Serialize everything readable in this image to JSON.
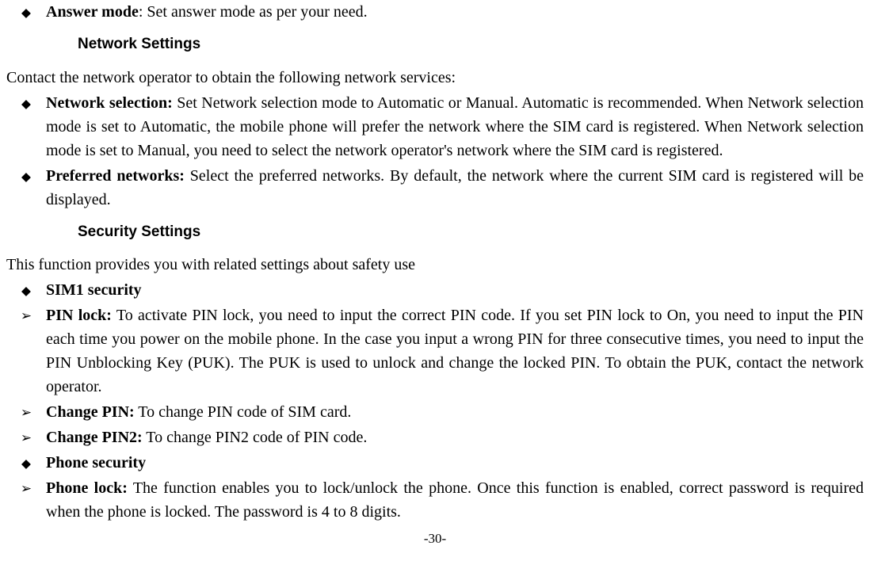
{
  "items": [
    {
      "bullet": "diamond",
      "label": "Answer mode",
      "sep": ": ",
      "text": "Set answer mode as per your need."
    }
  ],
  "heading1": "Network Settings",
  "para1": "Contact the network operator to obtain the following network services:",
  "networkItems": [
    {
      "bullet": "diamond",
      "label": "Network selection:",
      "text": " Set Network selection mode to Automatic or Manual. Automatic is recommended. When Network selection mode is set to Automatic, the mobile phone will prefer the network where the SIM card is registered. When Network selection mode is set to Manual, you need to select the network operator's network where the SIM card is registered."
    },
    {
      "bullet": "diamond",
      "label": "Preferred networks:",
      "text": " Select the preferred networks. By default, the network where the current SIM card is registered will be displayed."
    }
  ],
  "heading2": "Security Settings",
  "para2": "This function provides you with related settings about safety use",
  "securityItems": [
    {
      "bullet": "diamond",
      "label": "SIM1 security",
      "text": ""
    },
    {
      "bullet": "arrow",
      "label": "PIN lock:",
      "text": " To activate PIN lock, you need to input the correct PIN code. If you set PIN lock to On, you need to input the PIN each time you power on the mobile phone. In the case you input a wrong PIN for three consecutive times, you need to input the PIN Unblocking Key (PUK). The PUK is used to unlock and change the locked PIN. To obtain the PUK, contact the network operator."
    },
    {
      "bullet": "arrow",
      "label": "Change PIN:",
      "text": " To change PIN code of SIM card."
    },
    {
      "bullet": "arrow",
      "label": "Change PIN2:",
      "text": " To change PIN2 code of PIN code."
    },
    {
      "bullet": "diamond",
      "label": "Phone security",
      "text": ""
    },
    {
      "bullet": "arrow",
      "label": "Phone lock:",
      "text": " The function enables you to lock/unlock the phone. Once this function is enabled, correct password is required when the phone is locked. The password is 4 to 8 digits."
    }
  ],
  "pageNumber": "-30-",
  "bullets": {
    "diamond": "◆",
    "arrow": "➢"
  }
}
